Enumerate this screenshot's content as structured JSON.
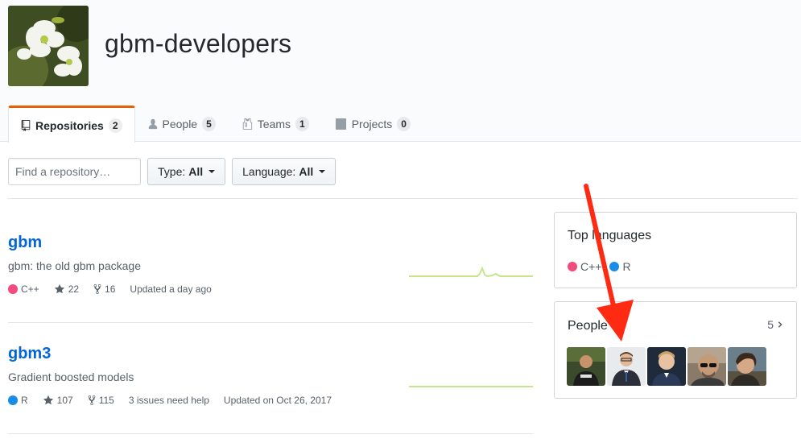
{
  "org": {
    "name": "gbm-developers"
  },
  "tabs": [
    {
      "label": "Repositories",
      "count": "2",
      "icon": "repo-icon"
    },
    {
      "label": "People",
      "count": "5",
      "icon": "person-icon"
    },
    {
      "label": "Teams",
      "count": "1",
      "icon": "jersey-icon"
    },
    {
      "label": "Projects",
      "count": "0",
      "icon": "project-icon"
    }
  ],
  "filters": {
    "search_placeholder": "Find a repository…",
    "type_label": "Type:",
    "type_value": "All",
    "language_label": "Language:",
    "language_value": "All"
  },
  "repos": [
    {
      "name": "gbm",
      "description": "gbm: the old gbm package",
      "language": "C++",
      "language_color": "#f34b7d",
      "stars": "22",
      "forks": "16",
      "issues": "",
      "updated": "Updated a day ago"
    },
    {
      "name": "gbm3",
      "description": "Gradient boosted models",
      "language": "R",
      "language_color": "#198ce7",
      "stars": "107",
      "forks": "115",
      "issues": "3 issues need help",
      "updated": "Updated on Oct 26, 2017"
    }
  ],
  "sidebar": {
    "top_languages_title": "Top languages",
    "languages": [
      {
        "name": "C++",
        "color": "#f34b7d"
      },
      {
        "name": "R",
        "color": "#198ce7"
      }
    ],
    "people_title": "People",
    "people_count": "5"
  },
  "colors": {
    "accent": "#0366d6",
    "tab_highlight": "#e36209",
    "annotation_arrow": "#ff2a12",
    "sparkline": "#c6e48b"
  }
}
